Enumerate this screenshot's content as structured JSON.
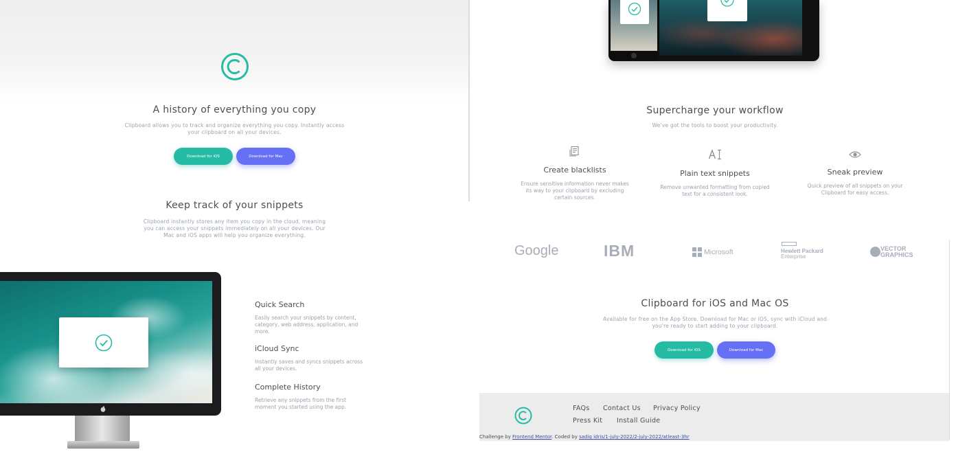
{
  "hero": {
    "title": "A history of everything you copy",
    "description_line1": "Clipboard allows you to track and organize everything you copy. Instantly access",
    "description_line2": "your clipboard on all your devices.",
    "ios_button": "Download for iOS",
    "mac_button": "Download for Mac"
  },
  "snippets": {
    "title": "Keep track of your snippets",
    "line1": "Clipboard instantly stores any item you copy in the cloud, meaning",
    "line2": "you can access your snippets immediately on all your devices. Our",
    "line3": "Mac and iOS apps will help you organize everything."
  },
  "features": [
    {
      "title": "Quick Search",
      "lines": [
        "Easily search your snippets by content,",
        "category, web address, application, and",
        "more."
      ]
    },
    {
      "title": "iCloud Sync",
      "lines": [
        "Instantly saves and syncs snippets across",
        "all your devices."
      ]
    },
    {
      "title": "Complete History",
      "lines": [
        "Retrieve any snippets from the first",
        "moment you started using the app."
      ]
    }
  ],
  "workflow": {
    "title": "Supercharge your workflow",
    "subtitle": "We've got the tools to boost your productivity.",
    "items": [
      {
        "title": "Create blacklists",
        "lines": [
          "Ensure sensitive information never makes",
          "its way to your clipboard by excluding",
          "certain sources."
        ]
      },
      {
        "title": "Plain text snippets",
        "lines": [
          "Remove unwanted formatting from copied",
          "text for a consistent look."
        ]
      },
      {
        "title": "Sneak preview",
        "lines": [
          "Quick preview of all snippets on your",
          "Clipboard for easy access."
        ]
      }
    ]
  },
  "partners": {
    "google": "Google",
    "ibm": "IBM",
    "microsoft": "Microsoft",
    "hp_line1": "Hewlett Packard",
    "hp_line2": "Enterprise",
    "vector_line1": "VECTOR",
    "vector_line2": "GRAPHICS"
  },
  "cta": {
    "title": "Clipboard for iOS and Mac OS",
    "line1": "Available for free on the App Store. Download for Mac or iOS, sync with iCloud and",
    "line2": "you're ready to start adding to your clipboard.",
    "ios_button": "Download for iOS",
    "mac_button": "Download for Mac"
  },
  "footer": {
    "links": [
      "FAQs",
      "Contact Us",
      "Privacy Policy",
      "Press Kit",
      "Install Guide"
    ],
    "attribution_prefix": "Challenge by",
    "attribution_link": "Frontend Mentor",
    "coded_by": ". Coded by",
    "author_link": "sadiq idris/1-july-2022/2-july-2022/atleast-3hr"
  },
  "colors": {
    "teal": "#26bba5",
    "indigo": "#6670f4",
    "heading": "#4c4d55",
    "text": "#9aa3ad",
    "footer_bg": "#ececec"
  }
}
